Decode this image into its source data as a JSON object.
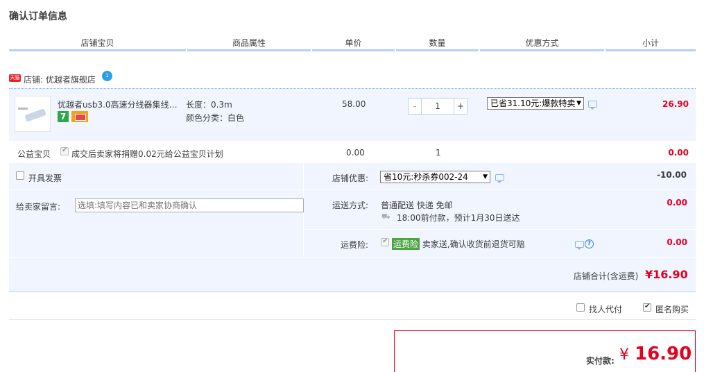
{
  "page": {
    "title": "确认订单信息"
  },
  "columns": [
    "店铺宝贝",
    "商品属性",
    "单价",
    "数量",
    "优惠方式",
    "小计"
  ],
  "shop": {
    "badge": "天猫",
    "label": "店铺: 优越者旗舰店",
    "chat_badge": "1"
  },
  "item": {
    "name": "优越者usb3.0高速分线器集线器…",
    "badge_seven": "7",
    "attr_length": "长度：0.3m",
    "attr_color": "颜色分类：白色",
    "price": "58.00",
    "qty_minus": "-",
    "quantity": "1",
    "qty_plus": "+",
    "promo": "已省31.10元:爆款特卖",
    "subtotal": "26.90"
  },
  "charity": {
    "label": "公益宝贝",
    "desc": "成交后卖家将捐赠0.02元给公益宝贝计划",
    "price": "0.00",
    "qty": "1",
    "subtotal": "0.00"
  },
  "invoice": {
    "label": "开具发票"
  },
  "shop_discount": {
    "label": "店铺优惠:",
    "value": "省10元:秒杀券002-24",
    "amount": "-10.00"
  },
  "message": {
    "label": "给卖家留言:",
    "placeholder": "选填:填写内容已和卖家协商确认"
  },
  "shipping": {
    "label": "运送方式:",
    "method": "普通配送 快递 免邮",
    "eta": "18:00前付款，预计1月30日送达",
    "amount": "0.00"
  },
  "insurance": {
    "label": "运费险:",
    "tag": "运费险",
    "desc": "卖家送,确认收货前退货可赔",
    "help": "?",
    "amount": "0.00"
  },
  "shop_total": {
    "label": "店铺合计(含运费)",
    "value": "¥16.90"
  },
  "options": {
    "proxy_pay": "找人代付",
    "anonymous": "匿名购买"
  },
  "payment": {
    "label": "实付款:",
    "currency": "¥",
    "value": "16.90"
  },
  "colors": {
    "accent_red": "#e5001e",
    "panel_bg": "#f0f5ff",
    "border_blue": "#b2d1ff"
  }
}
